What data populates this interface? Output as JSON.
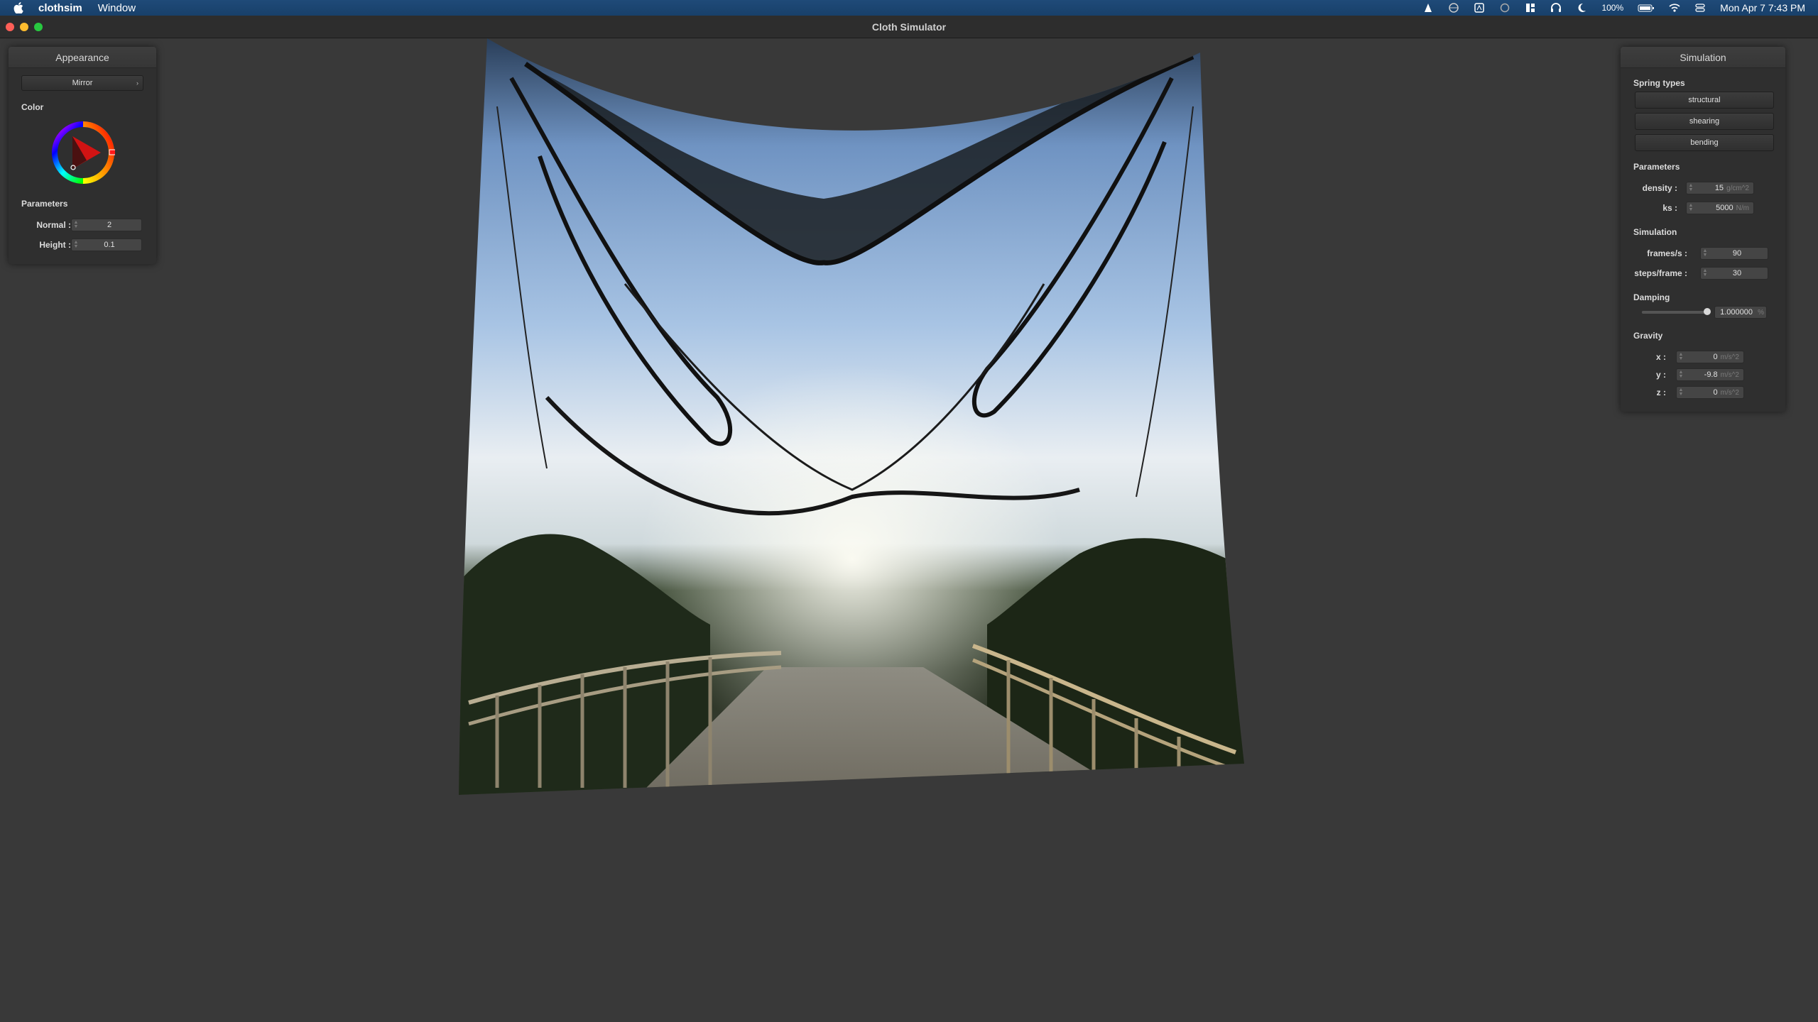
{
  "menubar": {
    "app_name": "clothsim",
    "menus": [
      "Window"
    ],
    "battery": "100%",
    "datetime": "Mon Apr 7  7:43 PM"
  },
  "window": {
    "title": "Cloth Simulator"
  },
  "appearance": {
    "title": "Appearance",
    "shader": "Mirror",
    "color_label": "Color",
    "parameters_label": "Parameters",
    "normal_label": "Normal :",
    "normal_value": "2",
    "height_label": "Height :",
    "height_value": "0.1"
  },
  "simulation": {
    "title": "Simulation",
    "spring_types_label": "Spring types",
    "spring_buttons": [
      "structural",
      "shearing",
      "bending"
    ],
    "parameters_label": "Parameters",
    "density_label": "density :",
    "density_value": "15",
    "density_unit": "g/cm^2",
    "ks_label": "ks :",
    "ks_value": "5000",
    "ks_unit": "N/m",
    "simulation_label": "Simulation",
    "fps_label": "frames/s :",
    "fps_value": "90",
    "steps_label": "steps/frame :",
    "steps_value": "30",
    "damping_label": "Damping",
    "damping_value": "1.000000",
    "damping_unit": "%",
    "damping_level": 1.0,
    "gravity_label": "Gravity",
    "gx_label": "x :",
    "gx_value": "0",
    "gy_label": "y :",
    "gy_value": "-9.8",
    "gz_label": "z :",
    "gz_value": "0",
    "gravity_unit": "m/s^2"
  }
}
